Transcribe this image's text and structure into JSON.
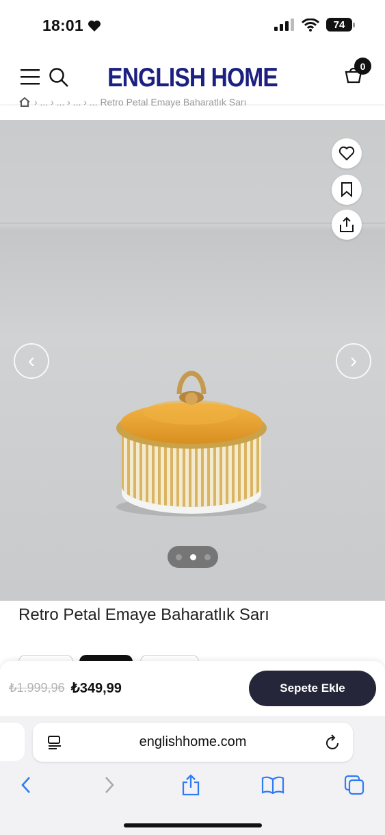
{
  "status_bar": {
    "time": "18:01",
    "battery": "74"
  },
  "header": {
    "brand": "ENGLISH HOME",
    "cart_count": "0"
  },
  "breadcrumb": {
    "text": "› ... › ... › ... › ... Retro Petal Emaye Baharatlık Sarı"
  },
  "product": {
    "title": "Retro Petal Emaye Baharatlık Sarı",
    "gallery": {
      "slide_count": 3,
      "active_slide": 2,
      "prev_arrow": "‹",
      "next_arrow": "›"
    },
    "actions": {
      "favorite_icon": "heart-icon",
      "save_icon": "bookmark-icon",
      "share_icon": "share-icon"
    }
  },
  "price_bar": {
    "old_price": "₺1.999,96",
    "new_price": "₺349,99",
    "add_to_cart_label": "Sepete Ekle"
  },
  "browser": {
    "url": "englishhome.com",
    "icons": [
      "back-icon",
      "forward-icon",
      "share-icon",
      "bookmarks-icon",
      "tabs-icon"
    ]
  },
  "colors": {
    "brand": "#1b2081",
    "cart_button": "#26263a",
    "lid": "#e8a53a"
  }
}
